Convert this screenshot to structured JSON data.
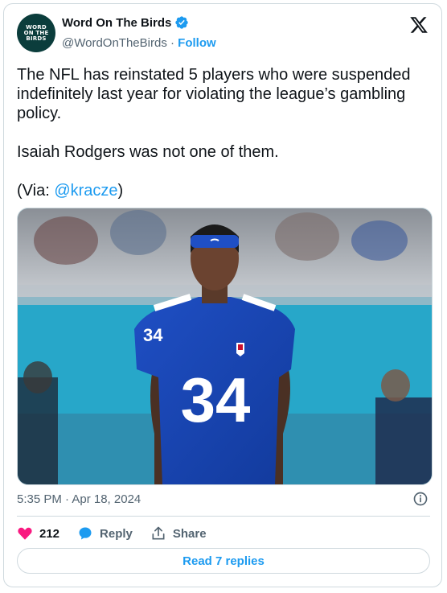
{
  "author": {
    "name": "Word On The Birds",
    "handle": "@WordOnTheBirds",
    "separator": "·",
    "follow_label": "Follow",
    "avatar_lines": [
      "WORD",
      "ON THE",
      "BIRDS"
    ]
  },
  "tweet": {
    "paragraph1": "The NFL has reinstated 5 players who were suspended indefinitely last year for violating the league’s gambling policy.",
    "paragraph2": "Isaiah Rodgers was not one of them.",
    "via_prefix": "(Via: ",
    "via_link": "@kracze",
    "via_suffix": ")"
  },
  "photo": {
    "jersey_number": "34"
  },
  "timestamp": "5:35 PM · Apr 18, 2024",
  "actions": {
    "like_count": "212",
    "reply_label": "Reply",
    "share_label": "Share"
  },
  "read_replies_label": "Read 7 replies",
  "colors": {
    "accent": "#1d9bf0",
    "like": "#f91880",
    "border": "#cfd9de",
    "secondary_text": "#536471"
  }
}
